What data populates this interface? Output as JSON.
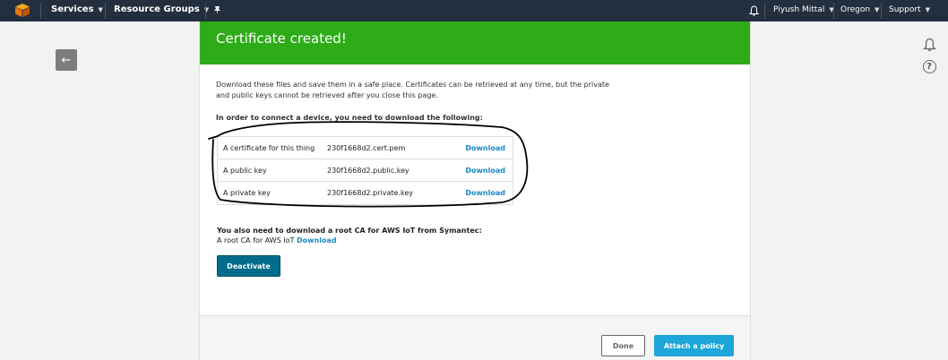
{
  "nav": {
    "services": "Services",
    "resource_groups": "Resource Groups",
    "user": "Piyush Mittal",
    "region": "Oregon",
    "support": "Support",
    "caret": "▼"
  },
  "back_icon": "←",
  "card": {
    "title": "Certificate created!",
    "intro_line1": "Download these files and save them in a safe place. Certificates can be retrieved at any time, but the private",
    "intro_line2": "and public keys cannot be retrieved after you close this page.",
    "req_heading": "In order to connect a device, you need to download the following:",
    "files": [
      {
        "label": "A certificate for this thing",
        "file": "230f1668d2.cert.pem",
        "action": "Download"
      },
      {
        "label": "A public key",
        "file": "230f1668d2.public.key",
        "action": "Download"
      },
      {
        "label": "A private key",
        "file": "230f1668d2.private.key",
        "action": "Download"
      }
    ],
    "root_heading": "You also need to download a root CA for AWS IoT from Symantec:",
    "root_label": "A root CA for AWS IoT",
    "root_link": "Download",
    "deactivate": "Deactivate",
    "done": "Done",
    "attach_policy": "Attach a policy"
  },
  "help_icon": "?",
  "colors": {
    "nav_bg": "#232f3e",
    "header_green": "#2eac18",
    "link_blue": "#1a8ac4",
    "deactivate_bg": "#006b8a",
    "primary_btn": "#1ca6d9"
  }
}
